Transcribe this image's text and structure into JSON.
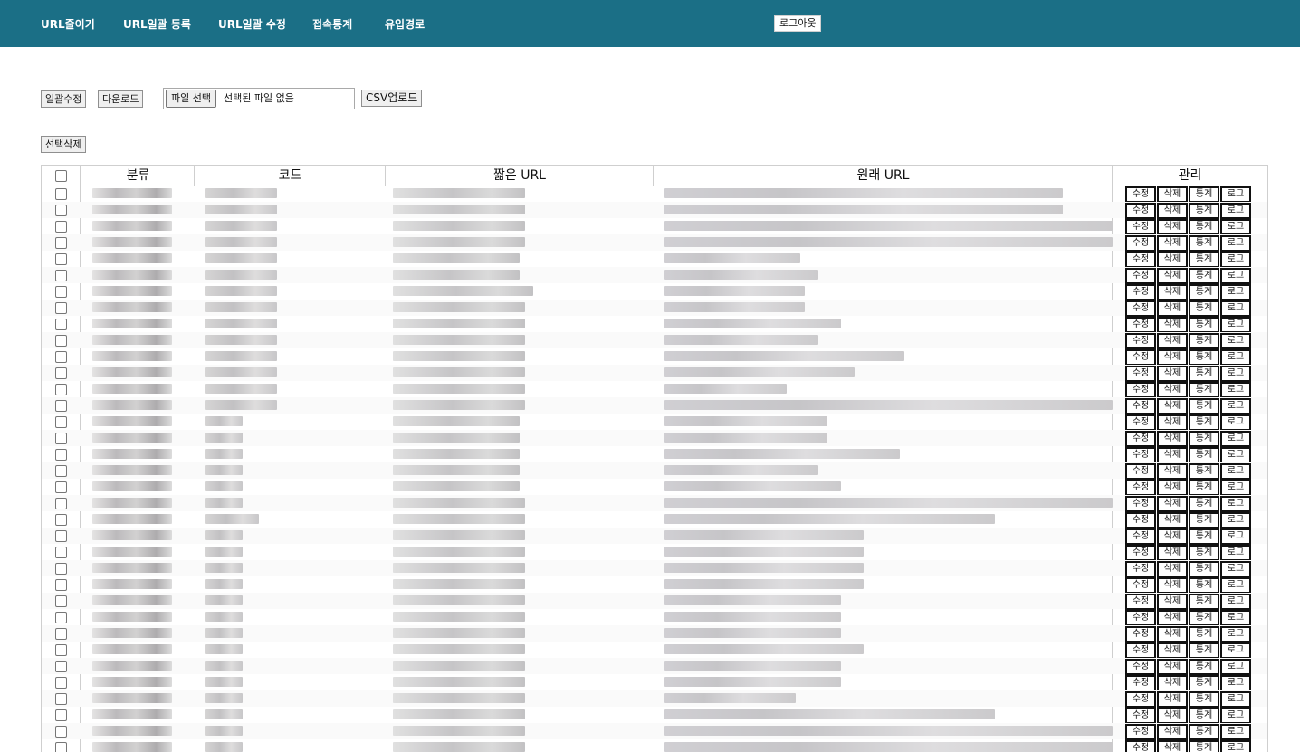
{
  "nav": {
    "items": [
      "URL줄이기",
      "URL일괄 등록",
      "URL일괄 수정",
      "접속통계",
      "유입경로"
    ],
    "logout_label": "로그아웃"
  },
  "toolbar": {
    "bulk_edit_label": "일괄수정",
    "download_label": "다운로드",
    "file_choose_label": "파일 선택",
    "file_status": "선택된 파일 없음",
    "csv_upload_label": "CSV업로드",
    "delete_selected_label": "선택삭제"
  },
  "table": {
    "headers": [
      "분류",
      "코드",
      "짧은 URL",
      "원래 URL",
      "관리"
    ],
    "action_labels": [
      "수정",
      "삭제",
      "통계",
      "로그"
    ],
    "row_count": 35
  },
  "colors": {
    "nav_background": "#1b6f86",
    "nav_text": "#ffffff"
  }
}
